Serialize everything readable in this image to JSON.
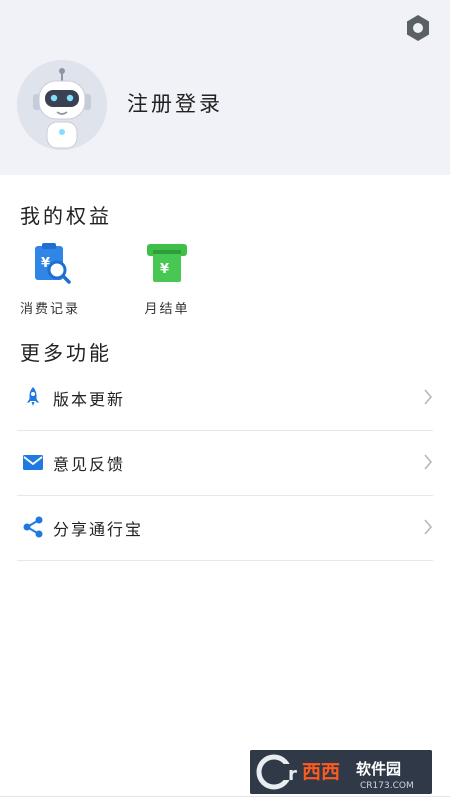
{
  "header": {
    "login_label": "注册登录",
    "settings_icon": "settings-hexagon-icon",
    "avatar_icon": "robot-avatar-icon"
  },
  "benefits": {
    "title": "我的权益",
    "items": [
      {
        "label": "消费记录",
        "icon": "consumption-record-icon",
        "color": "#2f86e6"
      },
      {
        "label": "月结单",
        "icon": "monthly-statement-icon",
        "color": "#3fbf4a"
      }
    ]
  },
  "more": {
    "title": "更多功能",
    "items": [
      {
        "label": "版本更新",
        "icon": "rocket-icon"
      },
      {
        "label": "意见反馈",
        "icon": "mail-icon"
      },
      {
        "label": "分享通行宝",
        "icon": "share-icon"
      }
    ]
  },
  "watermark": {
    "brand": "西西软件园",
    "url": "CR173.COM"
  },
  "colors": {
    "header_bg": "#f1f2f8",
    "accent_blue": "#1f7ae0",
    "green": "#3fbf4a"
  }
}
